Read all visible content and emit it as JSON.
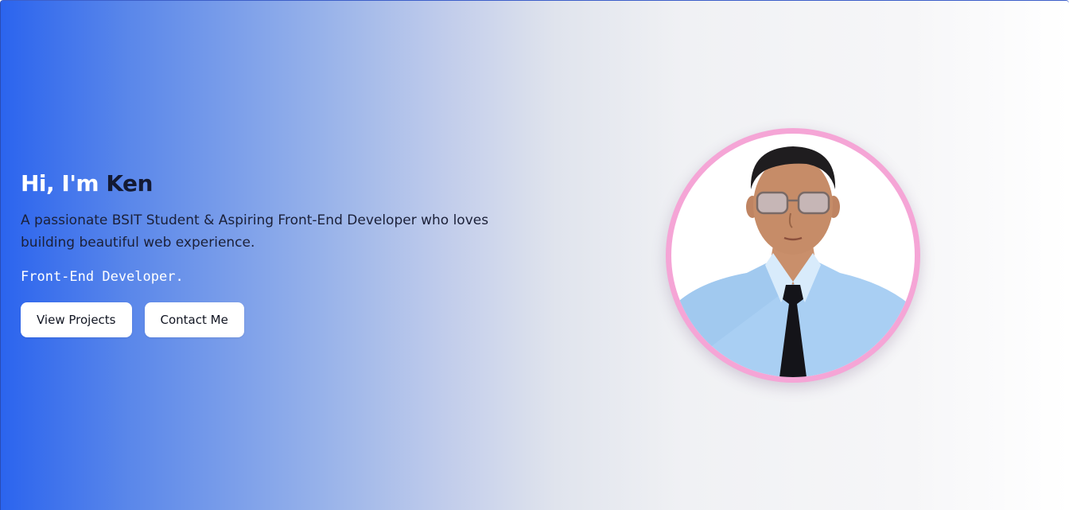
{
  "hero": {
    "greeting": "Hi, I'm",
    "name": "Ken",
    "tagline": "A passionate BSIT Student & Aspiring Front-End Developer who loves building beautiful web experience.",
    "role": "Front-End Developer.",
    "buttons": {
      "projects_label": "View Projects",
      "contact_label": "Contact Me"
    },
    "portrait_alt": "Ken portrait"
  },
  "colors": {
    "gradient_start": "#2b64ee",
    "gradient_end": "#ffffff",
    "frame_ring": "#f5a5d6",
    "name_text": "#141a33",
    "button_bg": "#ffffff"
  }
}
